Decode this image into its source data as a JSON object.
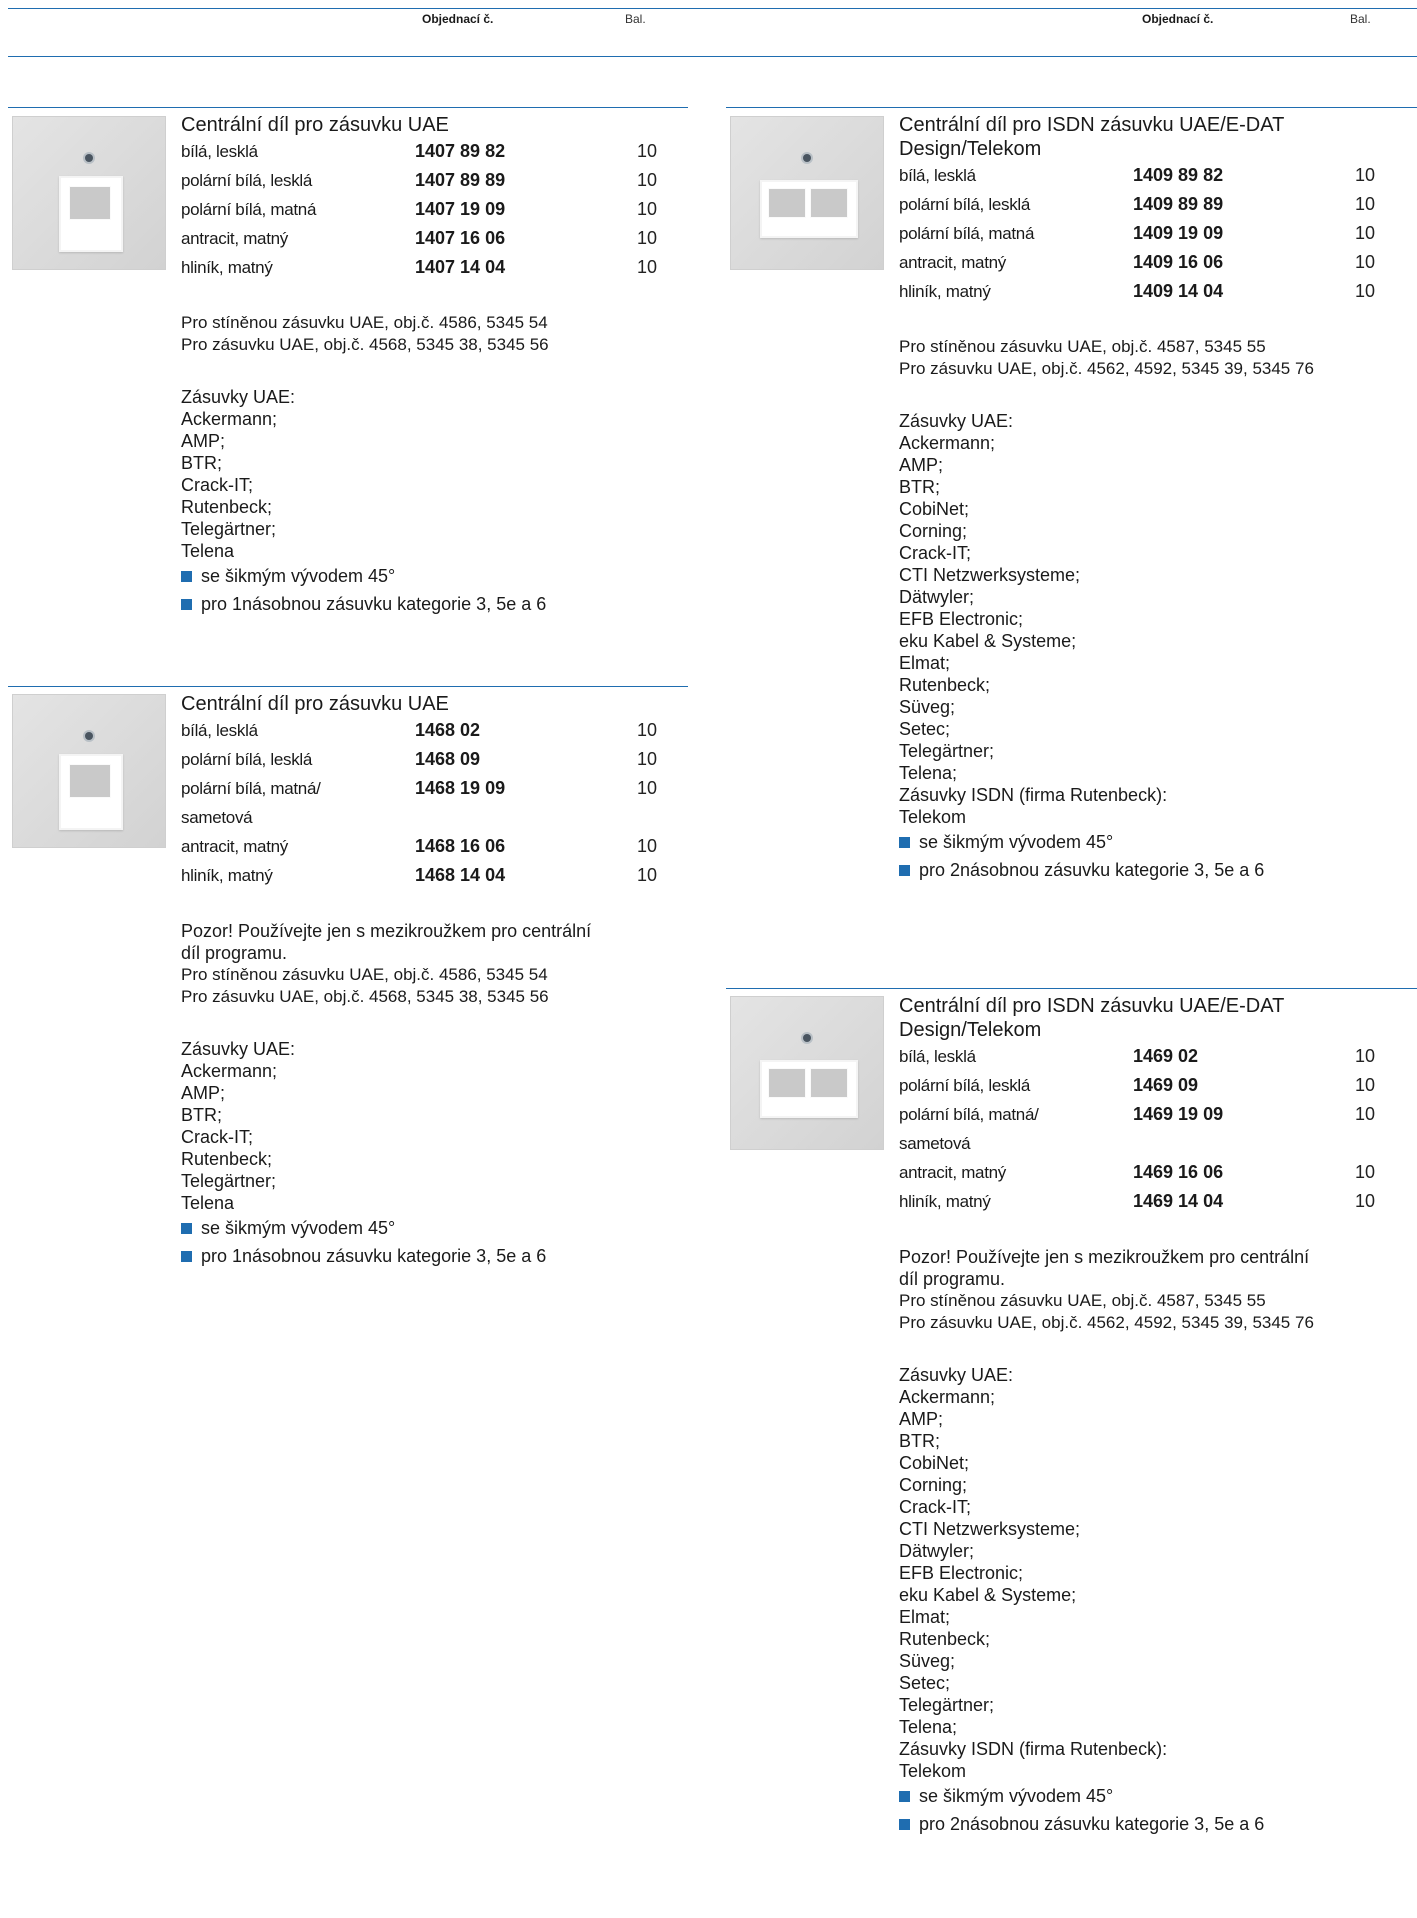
{
  "header": {
    "order_no_label": "Objednací č.",
    "pack_label": "Bal."
  },
  "colors": {
    "accent": "#1f6db0",
    "thumb": "#d8d8d8"
  },
  "products": [
    {
      "title": [
        "Centrální díl pro zásuvku UAE"
      ],
      "rows": [
        {
          "name": "bílá, lesklá",
          "code": "1407 89 82",
          "qty": "10"
        },
        {
          "name": "polární bílá, lesklá",
          "code": "1407 89 89",
          "qty": "10"
        },
        {
          "name": "polární bílá, matná",
          "code": "1407 19 09",
          "qty": "10"
        },
        {
          "name": "antracit, matný",
          "code": "1407 16 06",
          "qty": "10"
        },
        {
          "name": "hliník, matný",
          "code": "1407 14 04",
          "qty": "10"
        }
      ],
      "notes": [
        "Pro stíněnou zásuvku UAE, obj.č. 4586, 5345 54",
        "Pro zásuvku UAE, obj.č. 4568, 5345 38, 5345 56"
      ],
      "sockets_heading": "Zásuvky UAE:",
      "sockets": [
        "Ackermann;",
        "AMP;",
        "BTR;",
        "Crack-IT;",
        "Rutenbeck;",
        "Telegärtner;",
        "Telena"
      ],
      "bullets": [
        "se šikmým vývodem 45°",
        "pro 1násobnou zásuvku kategorie 3, 5e a 6"
      ]
    },
    {
      "title": [
        "Centrální díl pro zásuvku UAE"
      ],
      "rows": [
        {
          "name": "bílá, lesklá",
          "code": "1468 02",
          "qty": "10"
        },
        {
          "name": "polární bílá, lesklá",
          "code": "1468 09",
          "qty": "10"
        },
        {
          "name": "polární bílá, matná/",
          "name2": "sametová",
          "code": "1468 19 09",
          "qty": "10"
        },
        {
          "name": "antracit, matný",
          "code": "1468 16 06",
          "qty": "10"
        },
        {
          "name": "hliník, matný",
          "code": "1468 14 04",
          "qty": "10"
        }
      ],
      "warning": [
        "Pozor! Používejte jen s mezikroužkem pro centrální",
        "díl programu."
      ],
      "notes": [
        "Pro stíněnou zásuvku UAE, obj.č. 4586, 5345 54",
        "Pro zásuvku UAE, obj.č. 4568, 5345 38, 5345 56"
      ],
      "sockets_heading": "Zásuvky UAE:",
      "sockets": [
        "Ackermann;",
        "AMP;",
        "BTR;",
        "Crack-IT;",
        "Rutenbeck;",
        "Telegärtner;",
        "Telena"
      ],
      "bullets": [
        "se šikmým vývodem 45°",
        "pro 1násobnou zásuvku kategorie 3, 5e a 6"
      ]
    },
    {
      "title": [
        "Centrální díl pro ISDN zásuvku UAE/E-DAT",
        "Design/Telekom"
      ],
      "rows": [
        {
          "name": "bílá, lesklá",
          "code": "1409 89 82",
          "qty": "10"
        },
        {
          "name": "polární bílá, lesklá",
          "code": "1409 89 89",
          "qty": "10"
        },
        {
          "name": "polární bílá, matná",
          "code": "1409 19 09",
          "qty": "10"
        },
        {
          "name": "antracit, matný",
          "code": "1409 16 06",
          "qty": "10"
        },
        {
          "name": "hliník, matný",
          "code": "1409 14 04",
          "qty": "10"
        }
      ],
      "notes": [
        "Pro stíněnou zásuvku UAE, obj.č. 4587, 5345 55",
        "Pro zásuvku UAE, obj.č. 4562, 4592, 5345 39, 5345 76"
      ],
      "sockets_heading": "Zásuvky UAE:",
      "sockets": [
        "Ackermann;",
        "AMP;",
        "BTR;",
        "CobiNet;",
        "Corning;",
        "Crack-IT;",
        "CTI Netzwerksysteme;",
        "Dätwyler;",
        "EFB Electronic;",
        "eku Kabel & Systeme;",
        "Elmat;",
        "Rutenbeck;",
        "Süveg;",
        "Setec;",
        "Telegärtner;",
        "Telena;",
        "Zásuvky ISDN (firma Rutenbeck):",
        "Telekom"
      ],
      "bullets": [
        "se šikmým vývodem 45°",
        "pro 2násobnou zásuvku kategorie 3, 5e a 6"
      ]
    },
    {
      "title": [
        "Centrální díl pro ISDN zásuvku UAE/E-DAT",
        "Design/Telekom"
      ],
      "rows": [
        {
          "name": "bílá, lesklá",
          "code": "1469 02",
          "qty": "10"
        },
        {
          "name": "polární bílá, lesklá",
          "code": "1469 09",
          "qty": "10"
        },
        {
          "name": "polární bílá, matná/",
          "name2": "sametová",
          "code": "1469 19 09",
          "qty": "10"
        },
        {
          "name": "antracit, matný",
          "code": "1469 16 06",
          "qty": "10"
        },
        {
          "name": "hliník, matný",
          "code": "1469 14 04",
          "qty": "10"
        }
      ],
      "warning": [
        "Pozor! Používejte jen s mezikroužkem pro centrální",
        "díl programu."
      ],
      "notes": [
        "Pro stíněnou zásuvku UAE, obj.č. 4587, 5345 55",
        "Pro zásuvku UAE, obj.č. 4562, 4592, 5345 39, 5345 76"
      ],
      "sockets_heading": "Zásuvky UAE:",
      "sockets": [
        "Ackermann;",
        "AMP;",
        "BTR;",
        "CobiNet;",
        "Corning;",
        "Crack-IT;",
        "CTI Netzwerksysteme;",
        "Dätwyler;",
        "EFB Electronic;",
        "eku Kabel & Systeme;",
        "Elmat;",
        "Rutenbeck;",
        "Süveg;",
        "Setec;",
        "Telegärtner;",
        "Telena;",
        "Zásuvky ISDN (firma Rutenbeck):",
        "Telekom"
      ],
      "bullets": [
        "se šikmým vývodem 45°",
        "pro 2násobnou zásuvku kategorie 3, 5e a 6"
      ]
    }
  ]
}
